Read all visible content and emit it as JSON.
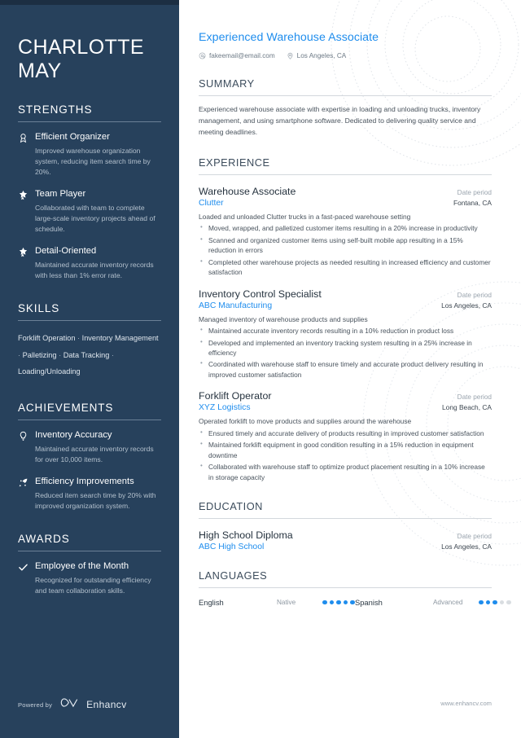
{
  "theme": {
    "sidebar_bg": "#27415c",
    "accent": "#1f8ded",
    "muted": "#b3c0cd"
  },
  "sidebar": {
    "name_line1": "CHARLOTTE",
    "name_line2": "MAY",
    "strengths": {
      "heading": "STRENGTHS",
      "items": [
        {
          "icon": "award-medal-icon",
          "title": "Efficient Organizer",
          "desc": "Improved warehouse organization system, reducing item search time by 20%."
        },
        {
          "icon": "star-badge-icon",
          "title": "Team Player",
          "desc": "Collaborated with team to complete large-scale inventory projects ahead of schedule."
        },
        {
          "icon": "star-badge-icon",
          "title": "Detail-Oriented",
          "desc": "Maintained accurate inventory records with less than 1% error rate."
        }
      ]
    },
    "skills": {
      "heading": "SKILLS",
      "items": [
        "Forklift Operation",
        "Inventory Management",
        "Palletizing",
        "Data Tracking",
        "Loading/Unloading"
      ],
      "separator": "·"
    },
    "achievements": {
      "heading": "ACHIEVEMENTS",
      "items": [
        {
          "icon": "lightbulb-icon",
          "title": "Inventory Accuracy",
          "desc": "Maintained accurate inventory records for over 10,000 items."
        },
        {
          "icon": "rocket-icon",
          "title": "Efficiency Improvements",
          "desc": "Reduced item search time by 20% with improved organization system."
        }
      ]
    },
    "awards": {
      "heading": "AWARDS",
      "items": [
        {
          "icon": "check-icon",
          "title": "Employee of the Month",
          "desc": "Recognized for outstanding efficiency and team collaboration skills."
        }
      ]
    },
    "footer": {
      "powered_by": "Powered by",
      "brand": "Enhancv",
      "logo_icon": "enhancv-infinity-logo"
    }
  },
  "main": {
    "headline": "Experienced Warehouse Associate",
    "contact": [
      {
        "icon": "email-icon",
        "value": "fakeemail@email.com"
      },
      {
        "icon": "location-pin-icon",
        "value": "Los Angeles, CA"
      }
    ],
    "summary": {
      "heading": "SUMMARY",
      "text": "Experienced warehouse associate with expertise in loading and unloading trucks, inventory management, and using smartphone software. Dedicated to delivering quality service and meeting deadlines."
    },
    "experience": {
      "heading": "EXPERIENCE",
      "entries": [
        {
          "title": "Warehouse Associate",
          "date": "Date period",
          "org": "Clutter",
          "location": "Fontana, CA",
          "lead": "Loaded and unloaded Clutter trucks in a fast-paced warehouse setting",
          "bullets": [
            "Moved, wrapped, and palletized customer items resulting in a 20% increase in productivity",
            "Scanned and organized customer items using self-built mobile app resulting in a 15% reduction in errors",
            "Completed other warehouse projects as needed resulting in increased efficiency and customer satisfaction"
          ]
        },
        {
          "title": "Inventory Control Specialist",
          "date": "Date period",
          "org": "ABC Manufacturing",
          "location": "Los Angeles, CA",
          "lead": "Managed inventory of warehouse products and supplies",
          "bullets": [
            "Maintained accurate inventory records resulting in a 10% reduction in product loss",
            "Developed and implemented an inventory tracking system resulting in a 25% increase in efficiency",
            "Coordinated with warehouse staff to ensure timely and accurate product delivery resulting in improved customer satisfaction"
          ]
        },
        {
          "title": "Forklift Operator",
          "date": "Date period",
          "org": "XYZ Logistics",
          "location": "Long Beach, CA",
          "lead": "Operated forklift to move products and supplies around the warehouse",
          "bullets": [
            "Ensured timely and accurate delivery of products resulting in improved customer satisfaction",
            "Maintained forklift equipment in good condition resulting in a 15% reduction in equipment downtime",
            "Collaborated with warehouse staff to optimize product placement resulting in a 10% increase in storage capacity"
          ]
        }
      ]
    },
    "education": {
      "heading": "EDUCATION",
      "entries": [
        {
          "title": "High School Diploma",
          "date": "Date period",
          "org": "ABC High School",
          "location": "Los Angeles, CA"
        }
      ]
    },
    "languages": {
      "heading": "LANGUAGES",
      "entries": [
        {
          "name": "English",
          "level": "Native",
          "filled": 5,
          "total": 5
        },
        {
          "name": "Spanish",
          "level": "Advanced",
          "filled": 3,
          "total": 5
        }
      ]
    },
    "site": "www.enhancv.com"
  }
}
